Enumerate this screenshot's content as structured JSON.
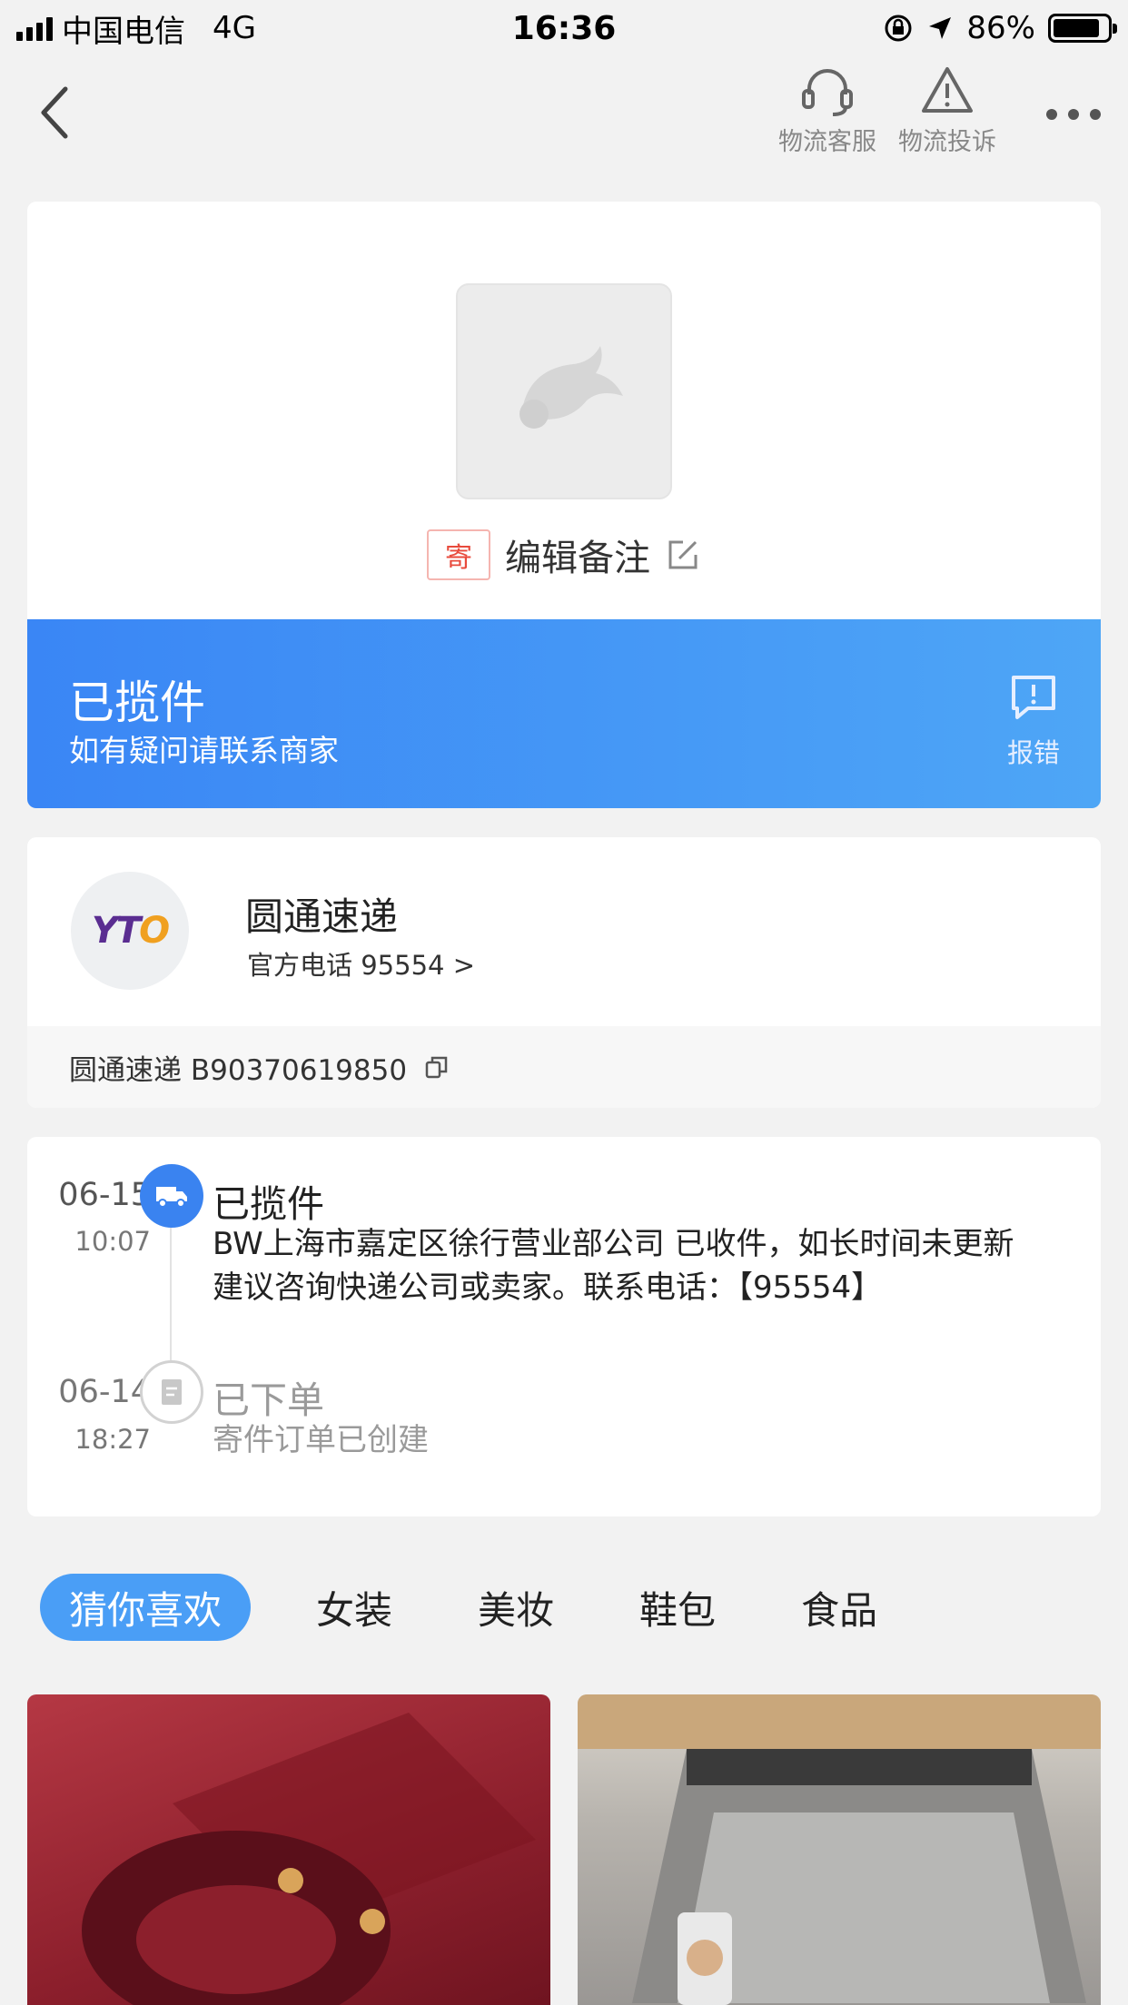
{
  "status_bar": {
    "carrier": "中国电信",
    "network": "4G",
    "time": "16:36",
    "battery": "86%"
  },
  "nav": {
    "service_label": "物流客服",
    "complaint_label": "物流投诉"
  },
  "parcel": {
    "tag": "寄",
    "remark_label": "编辑备注"
  },
  "status": {
    "title": "已揽件",
    "subtitle": "如有疑问请联系商家",
    "report_label": "报错"
  },
  "courier": {
    "logo_text_a": "YT",
    "logo_text_b": "O",
    "name": "圆通速递",
    "phone": "官方电话 95554 >",
    "tracking": "圆通速递 B90370619850"
  },
  "timeline": [
    {
      "date": "06-15",
      "time": "10:07",
      "title": "已揽件",
      "desc": "BW上海市嘉定区徐行营业部公司 已收件，如长时间未更新建议咨询快递公司或卖家。联系电话：【95554】"
    },
    {
      "date": "06-14",
      "time": "18:27",
      "title": "已下单",
      "desc": "寄件订单已创建"
    }
  ],
  "categories": [
    "猜你喜欢",
    "女装",
    "美妆",
    "鞋包",
    "食品"
  ],
  "colors": {
    "accent": "#3a86f5",
    "tag_red": "#e84a3c",
    "yto_purple": "#5a2d91"
  }
}
